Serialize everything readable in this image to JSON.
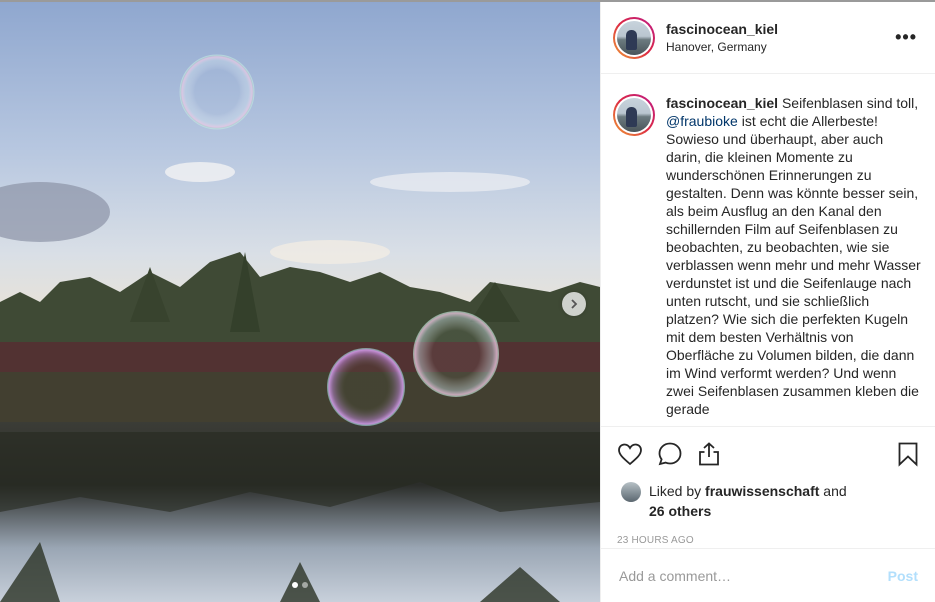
{
  "post": {
    "username": "fascinocean_kiel",
    "location": "Hanover, Germany",
    "more_icon": "•••",
    "caption_before_mention": " Seifenblasen sind toll, ",
    "mention": "@fraubioke",
    "caption_after_mention": " ist echt die Allerbeste! Sowieso und überhaupt, aber auch darin, die kleinen Momente zu wunderschönen Erinnerungen zu gestalten. Denn was könnte besser sein, als beim Ausflug an den Kanal den schillernden Film auf Seifenblasen zu beobachten, zu beobachten, wie sie verblassen wenn mehr und mehr Wasser verdunstet ist und die Seifenlauge nach unten rutscht, und sie schließlich platzen? Wie sich die perfekten Kugeln mit dem besten Verhältnis von Oberfläche zu Volumen bilden, die dann im Wind verformt werden? Und wenn zwei Seifenblasen zusammen kleben die gerade",
    "liked_by_prefix": "Liked by ",
    "liked_by_user": "frauwissenschaft",
    "liked_by_and": " and",
    "others": "26 others",
    "timestamp": "23 HOURS AGO",
    "comment_placeholder": "Add a comment…",
    "post_label": "Post"
  },
  "carousel": {
    "slides": 2,
    "active": 1
  },
  "icons": {
    "like": "heart-icon",
    "comment": "comment-icon",
    "share": "share-icon",
    "save": "bookmark-icon",
    "next": "chevron-right-icon"
  },
  "colors": {
    "mention": "#003569",
    "post_disabled": "#b2dffc",
    "timestamp": "#999999"
  }
}
